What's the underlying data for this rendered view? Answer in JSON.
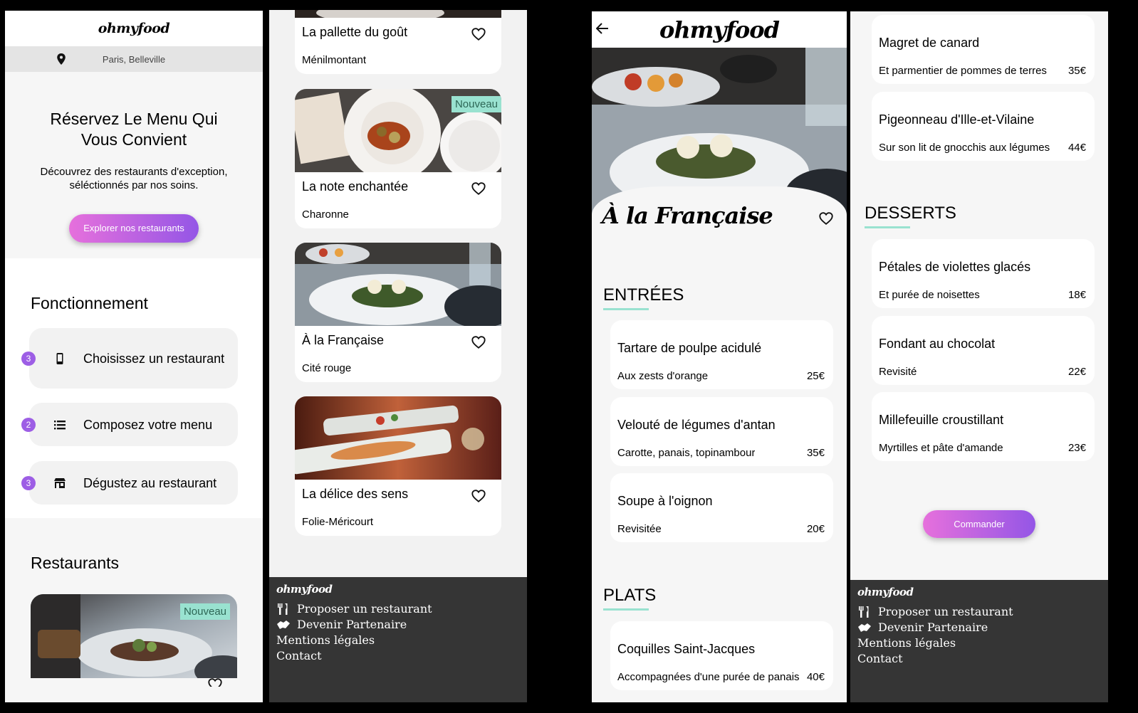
{
  "brand": "ohmyfood",
  "home": {
    "location": "Paris, Belleville",
    "hero_title": "Réservez Le Menu Qui Vous Convient",
    "hero_text": "Découvrez des restaurants d'exception, séléctionnés par nos soins.",
    "hero_button": "Explorer nos restaurants",
    "how_title": "Fonctionnement",
    "steps": [
      {
        "num": "3",
        "label": "Choisissez un restaurant",
        "icon": "phone-icon"
      },
      {
        "num": "2",
        "label": "Composez votre menu",
        "icon": "list-icon"
      },
      {
        "num": "3",
        "label": "Dégustez au restaurant",
        "icon": "store-icon"
      }
    ],
    "restaurants_title": "Restaurants",
    "first_card_badge": "Nouveau"
  },
  "restaurants": [
    {
      "name": "La pallette du goût",
      "location": "Ménilmontant",
      "badge": ""
    },
    {
      "name": "La note enchantée",
      "location": "Charonne",
      "badge": "Nouveau"
    },
    {
      "name": "À la Française",
      "location": "Cité rouge",
      "badge": ""
    },
    {
      "name": "La délice des sens",
      "location": "Folie-Méricourt",
      "badge": ""
    }
  ],
  "footer": {
    "logo": "ohmyfood",
    "links": [
      {
        "label": "Proposer un restaurant",
        "icon": "utensils-icon"
      },
      {
        "label": "Devenir Partenaire",
        "icon": "handshake-icon"
      },
      {
        "label": "Mentions légales",
        "icon": ""
      },
      {
        "label": "Contact",
        "icon": ""
      }
    ]
  },
  "menu_page": {
    "restaurant": "À la Française",
    "sections": {
      "entrees": {
        "title": "ENTRÉES",
        "dishes": [
          {
            "name": "Tartare de poulpe acidulé",
            "desc": "Aux zests d'orange",
            "price": "25€"
          },
          {
            "name": "Velouté de légumes d'antan",
            "desc": "Carotte, panais, topinambour",
            "price": "35€"
          },
          {
            "name": "Soupe à l'oignon",
            "desc": "Revisitée",
            "price": "20€"
          }
        ]
      },
      "plats": {
        "title": "PLATS",
        "dishes": [
          {
            "name": "Coquilles Saint-Jacques",
            "desc": "Accompagnées d'une purée de panais",
            "price": "40€"
          },
          {
            "name": "Magret de canard",
            "desc": "Et parmentier de pommes de terres",
            "price": "35€"
          },
          {
            "name": "Pigeonneau d'Ille-et-Vilaine",
            "desc": "Sur son lit de gnocchis aux légumes",
            "price": "44€"
          }
        ]
      },
      "desserts": {
        "title": "DESSERTS",
        "dishes": [
          {
            "name": "Pétales de violettes glacés",
            "desc": "Et purée de noisettes",
            "price": "18€"
          },
          {
            "name": "Fondant au chocolat",
            "desc": "Revisité",
            "price": "22€"
          },
          {
            "name": "Millefeuille croustillant",
            "desc": "Myrtilles et pâte d'amande",
            "price": "23€"
          }
        ]
      }
    },
    "order_button": "Commander"
  },
  "colors": {
    "accent_mint": "#99e2d0",
    "gradient_start": "#e670dc",
    "gradient_end": "#9456e6",
    "footer_bg": "#353535"
  }
}
